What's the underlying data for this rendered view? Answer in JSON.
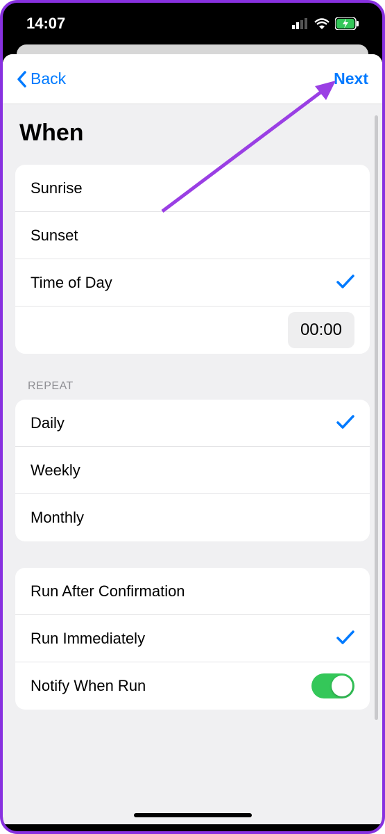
{
  "status": {
    "time": "14:07"
  },
  "nav": {
    "back": "Back",
    "next": "Next"
  },
  "title": "When",
  "when_group": {
    "items": [
      {
        "label": "Sunrise"
      },
      {
        "label": "Sunset"
      },
      {
        "label": "Time of Day",
        "selected": true
      }
    ],
    "time_value": "00:00"
  },
  "repeat_header": "REPEAT",
  "repeat_group": {
    "items": [
      {
        "label": "Daily",
        "selected": true
      },
      {
        "label": "Weekly"
      },
      {
        "label": "Monthly"
      }
    ]
  },
  "options_group": {
    "run_after": "Run After Confirmation",
    "run_immediate": "Run Immediately",
    "notify": "Notify When Run"
  }
}
